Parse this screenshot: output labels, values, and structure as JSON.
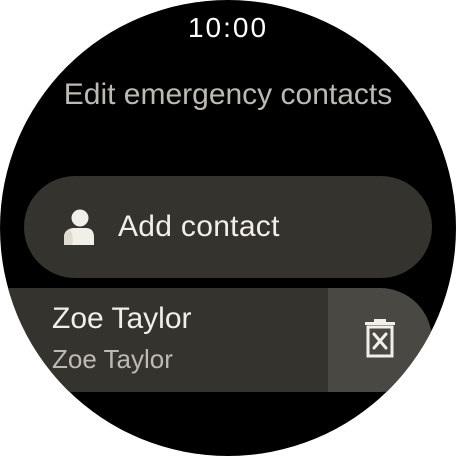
{
  "status_bar": {
    "time": "10:00"
  },
  "screen": {
    "title": "Edit emergency contacts"
  },
  "add_contact": {
    "label": "Add contact",
    "icon": "person-icon"
  },
  "contacts": [
    {
      "name": "Zoe Taylor",
      "detail": "Zoe Taylor",
      "delete_icon": "delete-icon"
    }
  ],
  "colors": {
    "background": "#000000",
    "chip": "#35332d",
    "delete_background": "#4a4843",
    "primary_text": "#f2efe8",
    "secondary_text": "#bdbab3"
  }
}
